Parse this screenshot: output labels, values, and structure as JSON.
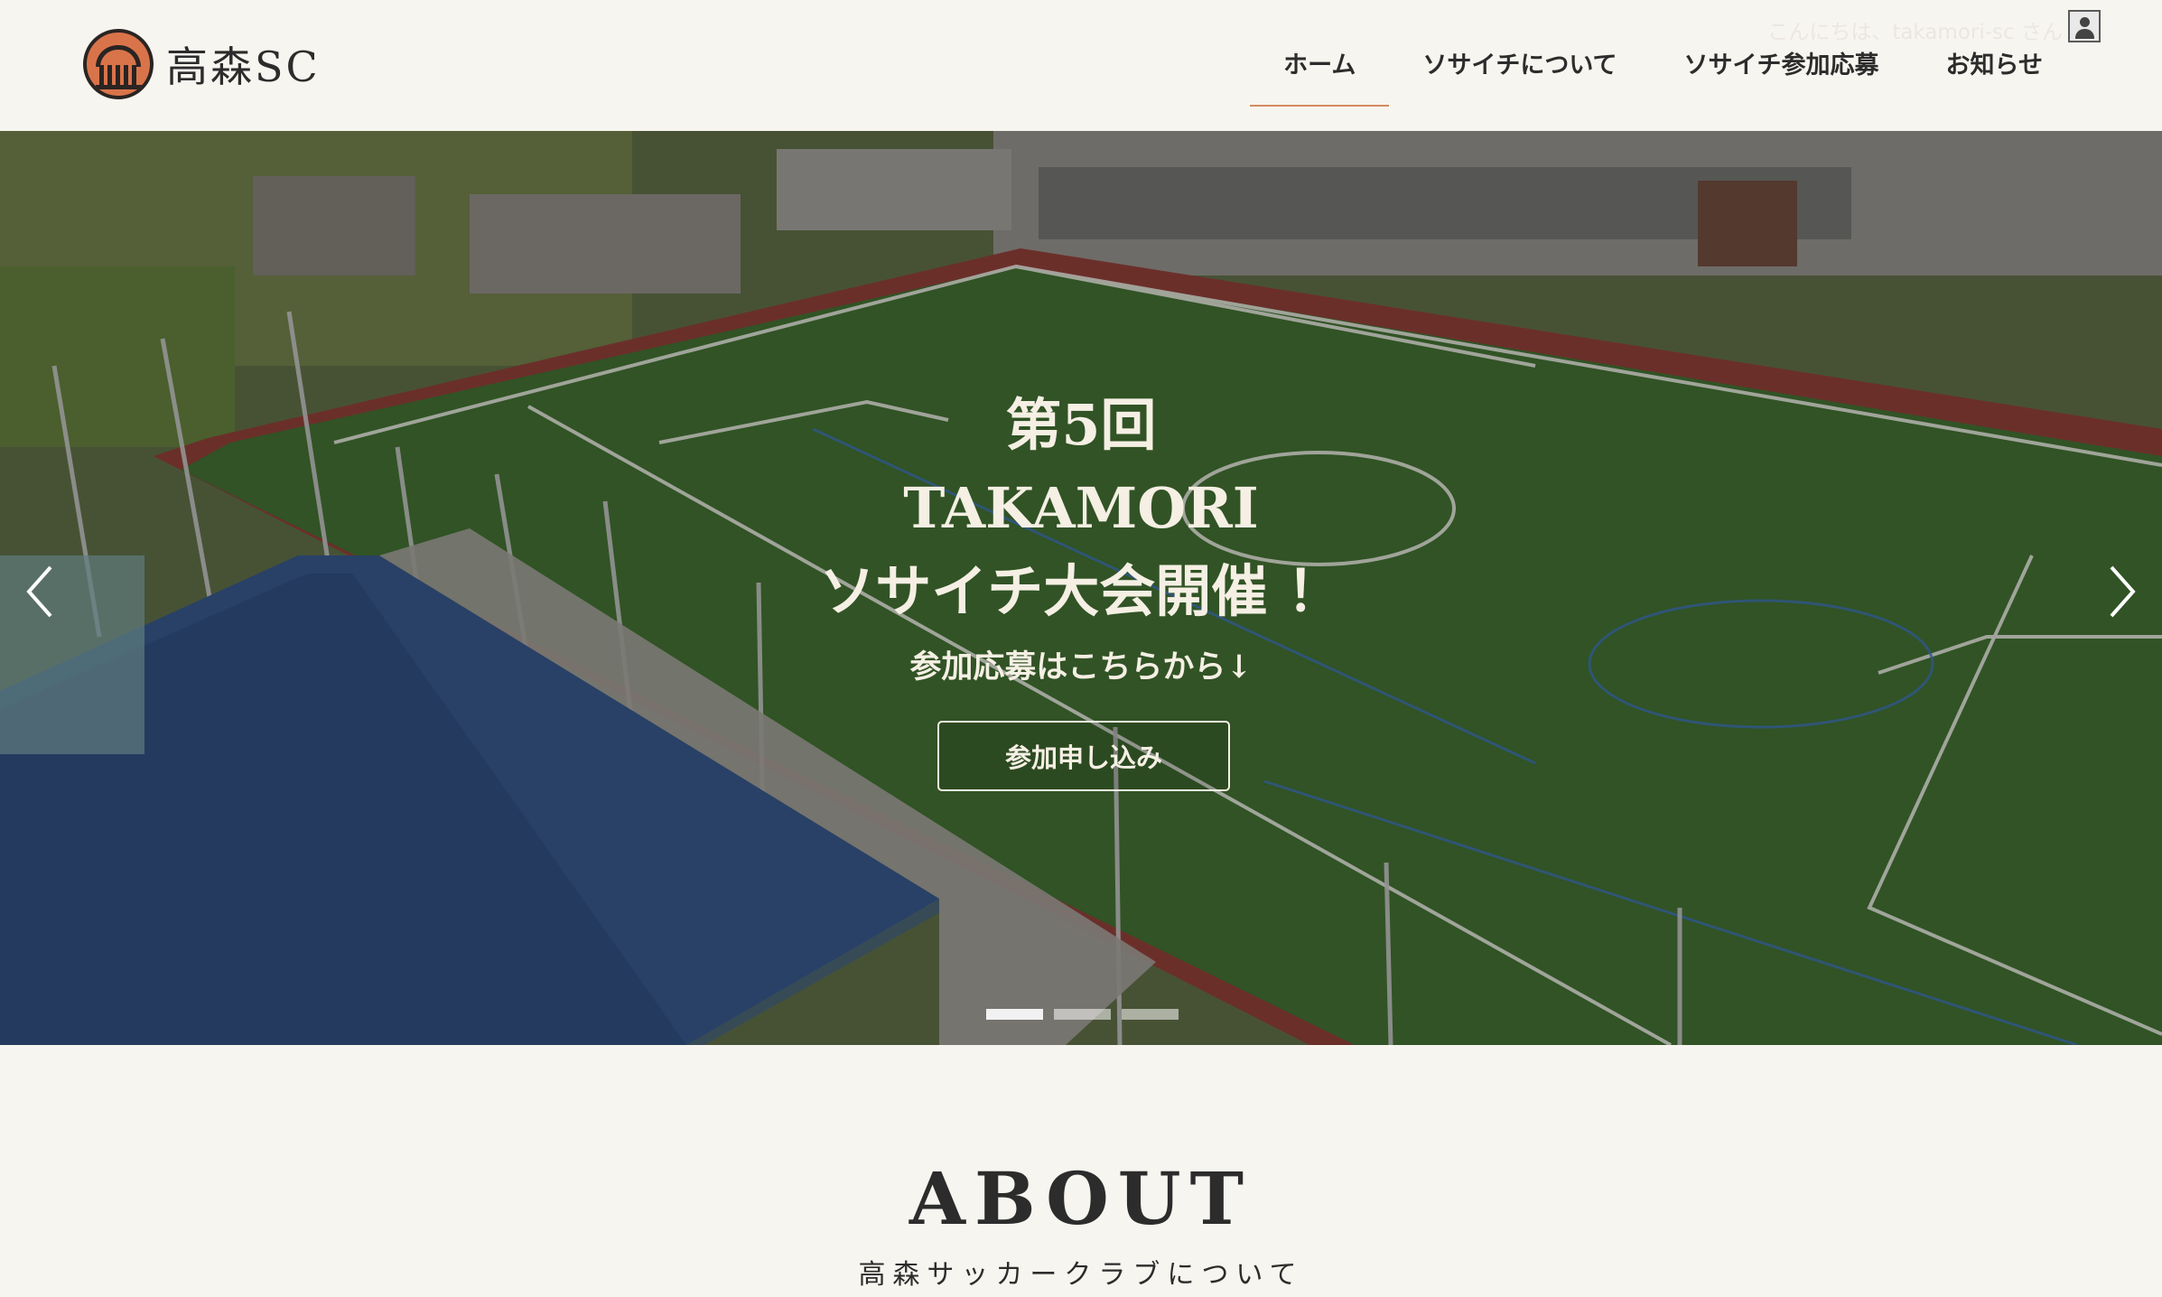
{
  "header": {
    "logo_text": "高森SC",
    "greeting": "こんにちは、takamori-sc さん",
    "nav": [
      {
        "label": "ホーム",
        "active": true
      },
      {
        "label": "ソサイチについて",
        "active": false
      },
      {
        "label": "ソサイチ参加応募",
        "active": false
      },
      {
        "label": "お知らせ",
        "active": false
      }
    ]
  },
  "hero": {
    "title_line1": "第5回",
    "title_line2": "TAKAMORI",
    "title_line3": "ソサイチ大会開催 ！",
    "subtitle": "参加応募はこちらから↓",
    "button_label": "参加申し込み",
    "slides": 3,
    "active_slide": 1
  },
  "about": {
    "title": "ABOUT",
    "subtitle": "高森サッカークラブについて"
  },
  "colors": {
    "background": "#f7f5ef",
    "accent": "#d58a60",
    "text": "#2c2c2c",
    "logo": "#d9744a"
  },
  "icons": [
    "user-avatar-icon",
    "chevron-left-icon",
    "chevron-right-icon"
  ]
}
